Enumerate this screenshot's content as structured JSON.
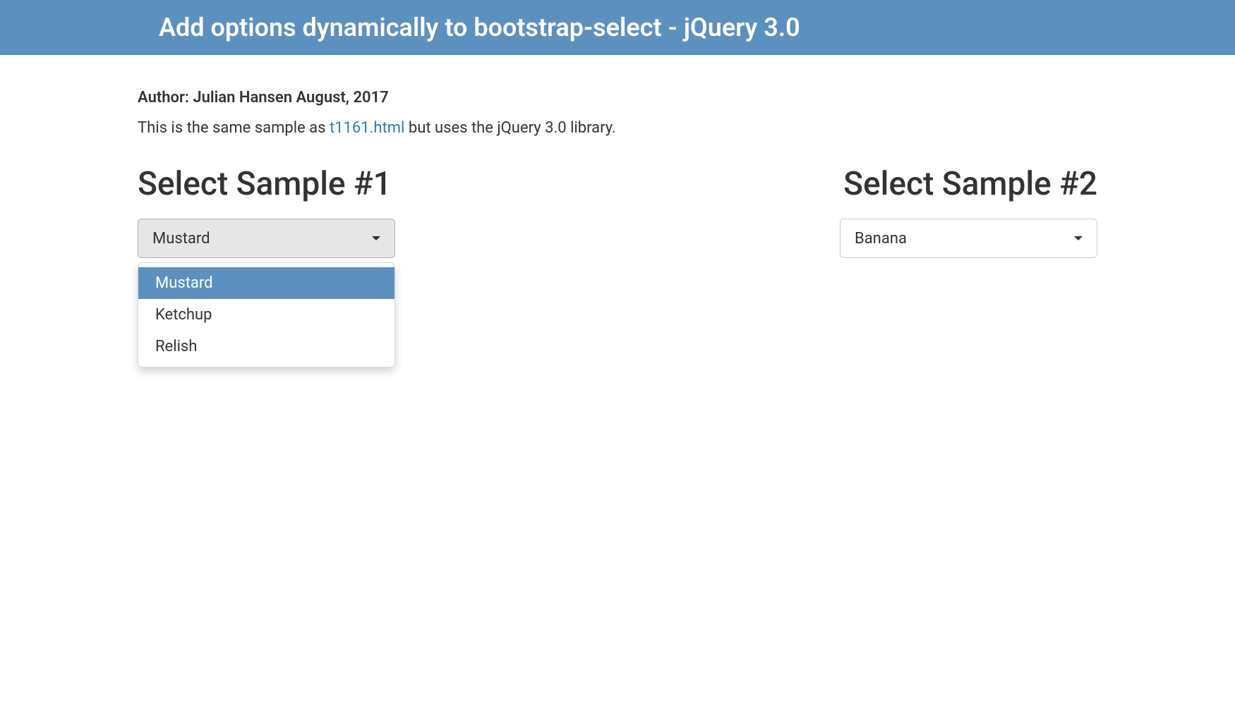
{
  "header": {
    "title": "Add options dynamically to bootstrap-select - jQuery 3.0"
  },
  "author_line": "Author: Julian Hansen August, 2017",
  "description": {
    "prefix": "This is the same sample as ",
    "link_text": "t1161.html",
    "suffix": " but uses the jQuery 3.0 library."
  },
  "select1": {
    "heading": "Select Sample #1",
    "selected": "Mustard",
    "options": [
      "Mustard",
      "Ketchup",
      "Relish"
    ]
  },
  "select2": {
    "heading": "Select Sample #2",
    "selected": "Banana"
  }
}
